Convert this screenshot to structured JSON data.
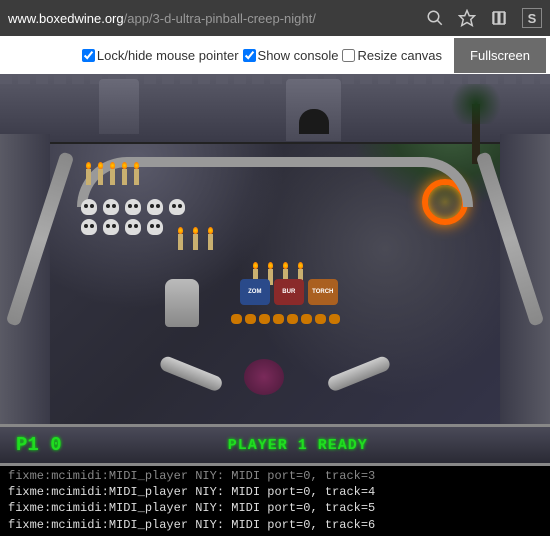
{
  "browser": {
    "domain": "www.boxedwine.org",
    "path": "/app/3-d-ultra-pinball-creep-night/",
    "s_label": "S"
  },
  "toolbar": {
    "lock_label": "Lock/hide mouse pointer",
    "lock_checked": true,
    "console_label": "Show console",
    "console_checked": true,
    "resize_label": "Resize canvas",
    "resize_checked": false,
    "fullscreen_label": "Fullscreen"
  },
  "game": {
    "score_label": "P1 0",
    "status": "PLAYER 1 READY",
    "targets": [
      "ZOM",
      "BUR",
      "TORCH"
    ]
  },
  "console_lines": [
    "fixme:mcimidi:MIDI_player NIY: MIDI port=0, track=3",
    "fixme:mcimidi:MIDI_player NIY: MIDI port=0, track=4",
    "fixme:mcimidi:MIDI_player NIY: MIDI port=0, track=5",
    "fixme:mcimidi:MIDI_player NIY: MIDI port=0, track=6"
  ]
}
